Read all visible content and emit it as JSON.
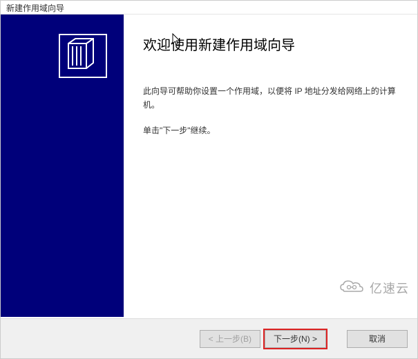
{
  "window": {
    "title": "新建作用域向导"
  },
  "main": {
    "heading": "欢迎使用新建作用域向导",
    "desc1": "此向导可帮助你设置一个作用域，以便将 IP 地址分发给网络上的计算机。",
    "desc2": "单击\"下一步\"继续。"
  },
  "buttons": {
    "back": "< 上一步(B)",
    "next": "下一步(N) >",
    "cancel": "取消"
  },
  "watermark": {
    "text": "亿速云"
  }
}
